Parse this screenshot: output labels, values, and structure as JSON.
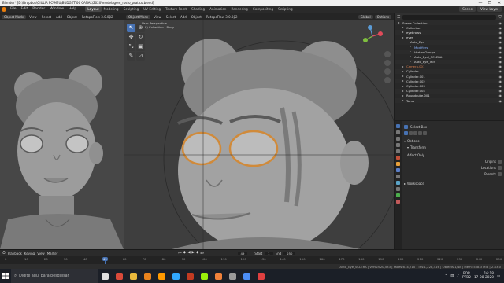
{
  "window": {
    "title": "Blender* [D:\\Dropbox\\GIULIA PC\\MEU\\BUDGET\\06 CANAL\\2020\\modelagem_rosto_pratico.blend]",
    "controls": [
      "—",
      "❐",
      "✕"
    ]
  },
  "menubar": {
    "items": [
      "File",
      "Edit",
      "Render",
      "Window",
      "Help"
    ],
    "workspaces": [
      "Layout",
      "Modeling",
      "Sculpting",
      "UV Editing",
      "Texture Paint",
      "Shading",
      "Animation",
      "Rendering",
      "Compositing",
      "Scripting"
    ],
    "active_workspace": "Layout",
    "scene_label": "Scene",
    "view_layer_label": "View Layer"
  },
  "left_viewport": {
    "mode": "Object Mode",
    "menus": [
      "View",
      "Select",
      "Add",
      "Object"
    ],
    "extra": "RetopoFlow 3.0.0β2"
  },
  "right_viewport": {
    "mode": "Object Mode",
    "menus": [
      "View",
      "Select",
      "Add",
      "Object"
    ],
    "extra": "RetopoFlow 3.0.0β2",
    "transform": "Global",
    "options": "Options",
    "info_line1": "User Perspective",
    "info_line2": "(49) Collection | Body"
  },
  "outliner": {
    "title": "Scene Collection",
    "search_placeholder": "",
    "rows": [
      {
        "label": "Scene Collection",
        "indent": 0,
        "color": "#ddd"
      },
      {
        "label": "Collection",
        "indent": 1,
        "color": "#ddd"
      },
      {
        "label": "eyebrows",
        "indent": 1,
        "color": "#ddd"
      },
      {
        "label": "eyes",
        "indent": 1,
        "color": "#ddd"
      },
      {
        "label": "Auto_Eye",
        "indent": 2,
        "color": "#ddd"
      },
      {
        "label": "Modifiers",
        "indent": 3,
        "color": "#8ab4ff"
      },
      {
        "label": "Vertex Groups",
        "indent": 3,
        "color": "#ddd"
      },
      {
        "label": "Auto_Eyel_SCLERA",
        "indent": 3,
        "color": "#ddd"
      },
      {
        "label": "Auto_Eye_IRIS",
        "indent": 3,
        "color": "#ddd"
      },
      {
        "label": "Camera.001",
        "indent": 1,
        "color": "#d87d4d"
      },
      {
        "label": "Cylinder",
        "indent": 1,
        "color": "#ddd"
      },
      {
        "label": "Cylinder.001",
        "indent": 1,
        "color": "#ddd"
      },
      {
        "label": "Cylinder.002",
        "indent": 1,
        "color": "#ddd"
      },
      {
        "label": "Cylinder.003",
        "indent": 1,
        "color": "#ddd"
      },
      {
        "label": "Cylinder.004",
        "indent": 1,
        "color": "#ddd"
      },
      {
        "label": "Roundcube.001",
        "indent": 1,
        "color": "#ddd"
      },
      {
        "label": "Torus",
        "indent": 1,
        "color": "#ddd"
      }
    ]
  },
  "properties": {
    "tool_name": "Select Box",
    "options_label": "Options",
    "transform_label": "Transform",
    "affect_only": "Affect Only",
    "origins": "Origins",
    "locations": "Locations",
    "parents": "Parents",
    "workspace": "Workspace"
  },
  "timeline": {
    "menus": [
      "Playback",
      "Keying",
      "View",
      "Marker"
    ],
    "frame": "49",
    "start_label": "Start",
    "start": "1",
    "end_label": "End",
    "end": "250",
    "ticks": [
      "0",
      "10",
      "20",
      "30",
      "40",
      "49",
      "60",
      "70",
      "80",
      "90",
      "100",
      "110",
      "120",
      "130",
      "140",
      "150",
      "160",
      "170",
      "180",
      "190",
      "200",
      "210",
      "220",
      "230",
      "240",
      "250"
    ]
  },
  "statusbar": {
    "stats": "Auto_Eye_SCLERA | Verts:620,533 | Faces:614,710 | Tris:1,228,416 | Objects:1/48 | Mem: 558.3 MiB | 2.83.0"
  },
  "taskbar": {
    "search_placeholder": "Digite aqui para pesquisar",
    "apps": [
      {
        "name": "task-view",
        "color": "#e0e0e0"
      },
      {
        "name": "chrome",
        "color": "#d94a3a"
      },
      {
        "name": "file-explorer",
        "color": "#e8b83c"
      },
      {
        "name": "blender",
        "color": "#e8821d"
      },
      {
        "name": "illustrator",
        "color": "#ff9a00"
      },
      {
        "name": "photoshop",
        "color": "#31a8ff"
      },
      {
        "name": "media",
        "color": "#c23b22"
      },
      {
        "name": "xbox",
        "color": "#9bf00b"
      },
      {
        "name": "app-orange",
        "color": "#f0813a"
      },
      {
        "name": "app-gray",
        "color": "#9a9a9a"
      },
      {
        "name": "app-blue",
        "color": "#4c8ef5"
      },
      {
        "name": "app-red",
        "color": "#e04040"
      }
    ],
    "language": "POR",
    "layout": "PTB2",
    "time": "16:18",
    "date": "17-08-2020"
  }
}
